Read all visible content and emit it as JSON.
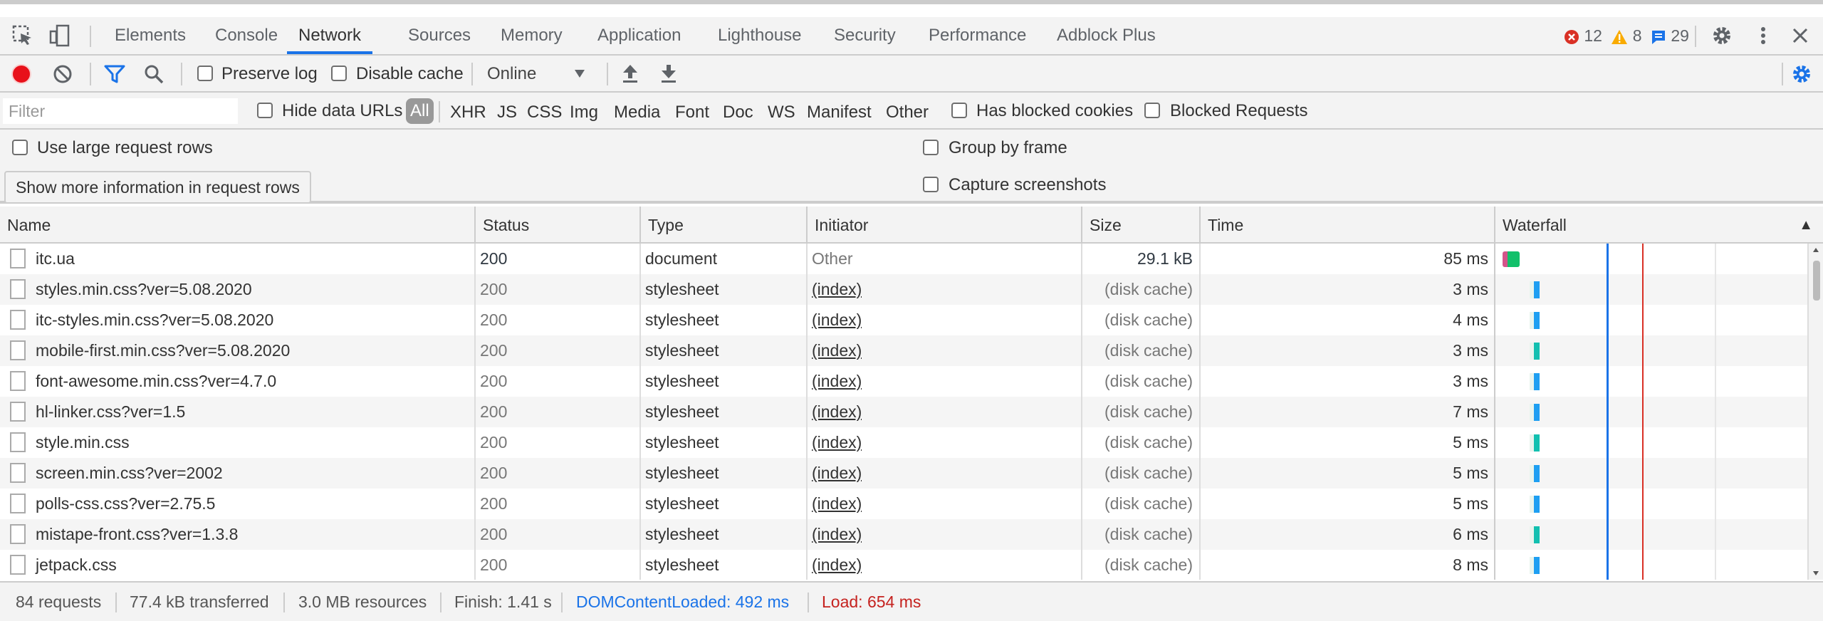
{
  "tabs": [
    "Elements",
    "Console",
    "Network",
    "Sources",
    "Memory",
    "Application",
    "Lighthouse",
    "Security",
    "Performance",
    "Adblock Plus"
  ],
  "active_tab": "Network",
  "counts": {
    "errors": "12",
    "warnings": "8",
    "messages": "29"
  },
  "toolbar": {
    "preserve_log": "Preserve log",
    "disable_cache": "Disable cache",
    "throttling": "Online"
  },
  "filter": {
    "placeholder": "Filter",
    "hide_data_urls": "Hide data URLs",
    "types": [
      "All",
      "XHR",
      "JS",
      "CSS",
      "Img",
      "Media",
      "Font",
      "Doc",
      "WS",
      "Manifest",
      "Other"
    ],
    "has_blocked_cookies": "Has blocked cookies",
    "blocked_requests": "Blocked Requests"
  },
  "settings": {
    "large_rows": "Use large request rows",
    "more_info_tooltip": "Show more information in request rows",
    "group_by_frame": "Group by frame",
    "capture_screenshots": "Capture screenshots"
  },
  "columns": {
    "name": "Name",
    "status": "Status",
    "type": "Type",
    "initiator": "Initiator",
    "size": "Size",
    "time": "Time",
    "waterfall": "Waterfall",
    "sort_arrow": "▲"
  },
  "rows": [
    {
      "name": "itc.ua",
      "status": "200",
      "type": "document",
      "initiator": "Other",
      "size": "29.1 kB",
      "time": "85 ms"
    },
    {
      "name": "styles.min.css?ver=5.08.2020",
      "status": "200",
      "type": "stylesheet",
      "initiator": "(index)",
      "size": "(disk cache)",
      "time": "3 ms"
    },
    {
      "name": "itc-styles.min.css?ver=5.08.2020",
      "status": "200",
      "type": "stylesheet",
      "initiator": "(index)",
      "size": "(disk cache)",
      "time": "4 ms"
    },
    {
      "name": "mobile-first.min.css?ver=5.08.2020",
      "status": "200",
      "type": "stylesheet",
      "initiator": "(index)",
      "size": "(disk cache)",
      "time": "3 ms"
    },
    {
      "name": "font-awesome.min.css?ver=4.7.0",
      "status": "200",
      "type": "stylesheet",
      "initiator": "(index)",
      "size": "(disk cache)",
      "time": "3 ms"
    },
    {
      "name": "hl-linker.css?ver=1.5",
      "status": "200",
      "type": "stylesheet",
      "initiator": "(index)",
      "size": "(disk cache)",
      "time": "7 ms"
    },
    {
      "name": "style.min.css",
      "status": "200",
      "type": "stylesheet",
      "initiator": "(index)",
      "size": "(disk cache)",
      "time": "5 ms"
    },
    {
      "name": "screen.min.css?ver=2002",
      "status": "200",
      "type": "stylesheet",
      "initiator": "(index)",
      "size": "(disk cache)",
      "time": "5 ms"
    },
    {
      "name": "polls-css.css?ver=2.75.5",
      "status": "200",
      "type": "stylesheet",
      "initiator": "(index)",
      "size": "(disk cache)",
      "time": "5 ms"
    },
    {
      "name": "mistape-front.css?ver=1.3.8",
      "status": "200",
      "type": "stylesheet",
      "initiator": "(index)",
      "size": "(disk cache)",
      "time": "6 ms"
    },
    {
      "name": "jetpack.css",
      "status": "200",
      "type": "stylesheet",
      "initiator": "(index)",
      "size": "(disk cache)",
      "time": "8 ms"
    }
  ],
  "summary": {
    "requests": "84 requests",
    "transferred": "77.4 kB transferred",
    "resources": "3.0 MB resources",
    "finish": "Finish: 1.41 s",
    "dcl": "DOMContentLoaded: 492 ms",
    "load": "Load: 654 ms"
  },
  "colors": {
    "accent": "#1a73e8",
    "record": "#e8111a",
    "error": "#d93025",
    "warning": "#f9ab00",
    "dcl_line": "#1a73e8",
    "load_line": "#d93025",
    "waterfall_bar": "#1e9ff2",
    "waterfall_doc": "#12c06a"
  },
  "icons": [
    "inspect-icon",
    "device-toolbar-icon",
    "error-icon",
    "warning-icon",
    "message-icon",
    "gear-icon",
    "kebab-menu-icon",
    "close-icon",
    "record-icon",
    "clear-icon",
    "filter-icon",
    "search-icon",
    "dropdown-arrow-icon",
    "upload-icon",
    "download-icon",
    "network-settings-icon",
    "document-icon"
  ]
}
